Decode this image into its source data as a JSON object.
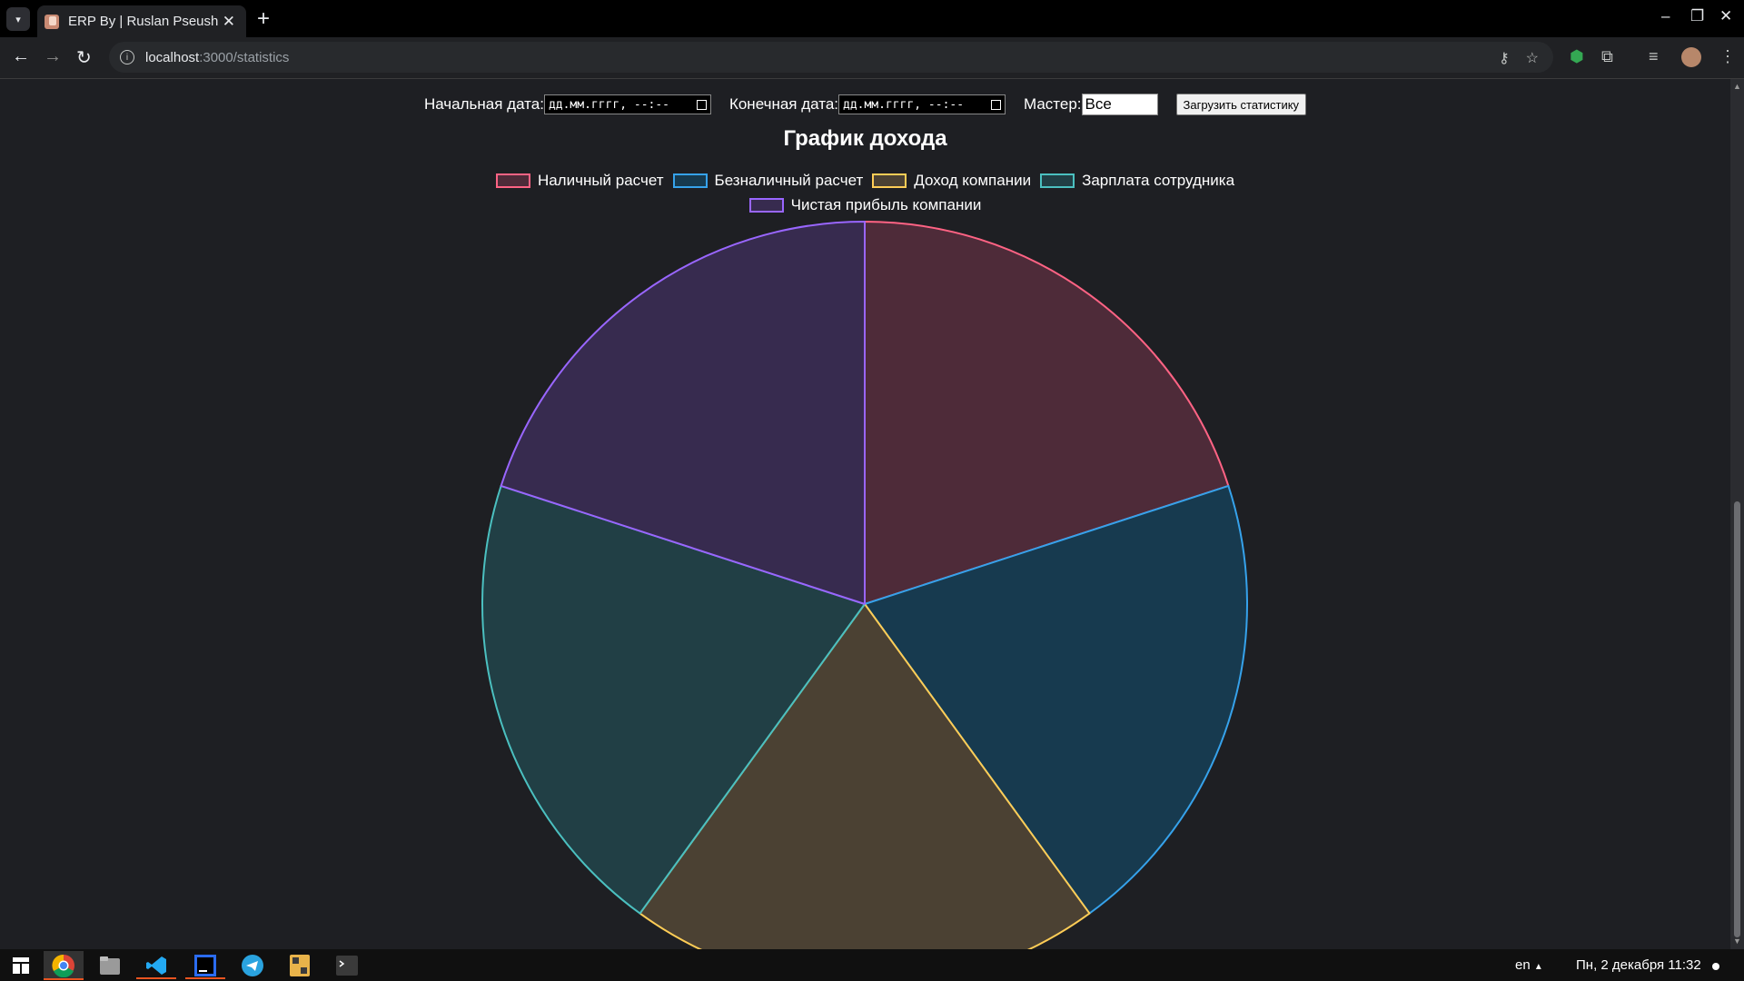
{
  "browser": {
    "tab_title": "ERP By | Ruslan Pseush",
    "url_host": "localhost",
    "url_path": ":3000/statistics"
  },
  "filters": {
    "start_label": "Начальная дата:",
    "start_placeholder": "дд.мм.гггг, --:--",
    "end_label": "Конечная дата:",
    "end_placeholder": "дд.мм.гггг, --:--",
    "master_label": "Мастер:",
    "master_value": "Все",
    "load_button": "Загрузить статистику"
  },
  "chart_data": {
    "type": "pie",
    "title": "График дохода",
    "legend_position": "top",
    "series": [
      {
        "name": "Наличный расчет",
        "value": 1,
        "border": "#ff6384",
        "fill": "#4e2b39"
      },
      {
        "name": "Безналичный расчет",
        "value": 1,
        "border": "#36a2eb",
        "fill": "#173a4f"
      },
      {
        "name": "Доход компании",
        "value": 1,
        "border": "#ffcd56",
        "fill": "#4b4133"
      },
      {
        "name": "Зарплата сотрудника",
        "value": 1,
        "border": "#4bc0c0",
        "fill": "#213f45"
      },
      {
        "name": "Чистая прибыль компании",
        "value": 1,
        "border": "#9966ff",
        "fill": "#372b4f"
      }
    ]
  },
  "taskbar": {
    "lang": "en",
    "datetime": "Пн, 2 декабря  11:32"
  }
}
